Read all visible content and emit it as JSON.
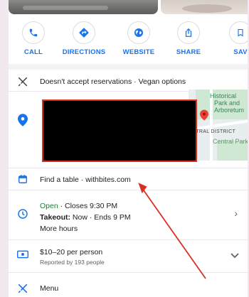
{
  "actions": [
    {
      "label": "CALL",
      "icon": "phone-icon"
    },
    {
      "label": "DIRECTIONS",
      "icon": "directions-icon"
    },
    {
      "label": "WEBSITE",
      "icon": "globe-icon"
    },
    {
      "label": "SHARE",
      "icon": "share-icon"
    },
    {
      "label": "SAV",
      "icon": "bookmark-icon"
    }
  ],
  "reservations": {
    "text": "Doesn't accept reservations · Vegan options"
  },
  "map": {
    "park_label_1": "Historical",
    "park_label_2": "Park and",
    "park_label_3": "Arboretum",
    "district_label": "ENTRAL DISTRICT",
    "park_label_4": "Central Park"
  },
  "find_table": {
    "text": "Find a table · withbites.com"
  },
  "hours": {
    "status": "Open",
    "closes": " · Closes 9:30 PM",
    "takeout_label": "Takeout:",
    "takeout_value": " Now · Ends 9 PM",
    "more": "More hours"
  },
  "price": {
    "text": "$10–20 per person",
    "sub": "Reported by 193 people"
  },
  "menu": {
    "text": "Menu"
  },
  "colors": {
    "accent": "#1a73e8",
    "annotation": "#d93025",
    "open": "#188038"
  }
}
